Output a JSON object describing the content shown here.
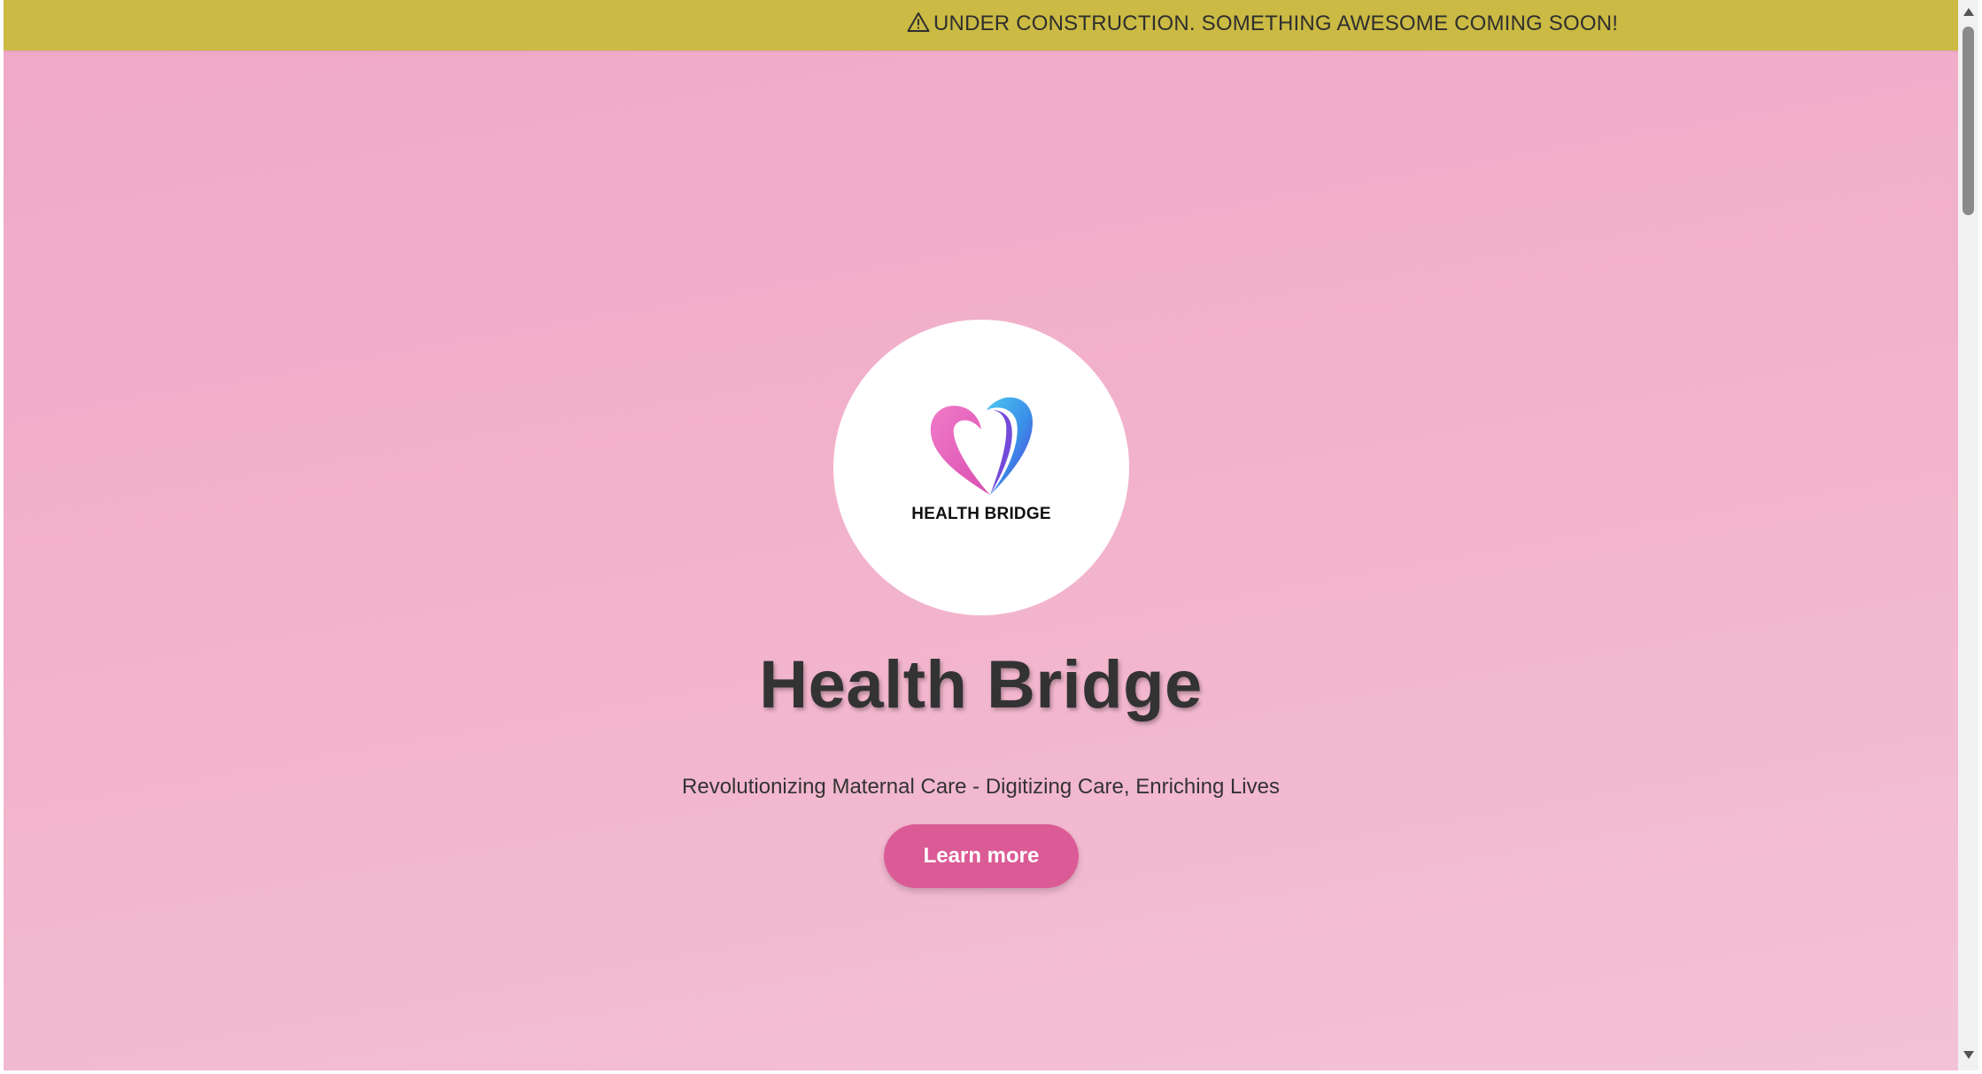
{
  "banner": {
    "icon": "warning-icon",
    "text": "UNDER CONSTRUCTION. SOMETHING AWESOME COMING SOON!",
    "color": "#cbba43"
  },
  "hero": {
    "logo_text": "HEALTH BRIDGE",
    "title": "Health Bridge",
    "subtitle": "Revolutionizing Maternal Care - Digitizing Care, Enriching Lives",
    "cta_label": "Learn more"
  },
  "colors": {
    "background": "#f2b4cc",
    "button": "#db5b96",
    "heart_pink": "#e35fbc",
    "heart_blue": "#3fb0e8",
    "heart_purple": "#6a2fd6"
  }
}
